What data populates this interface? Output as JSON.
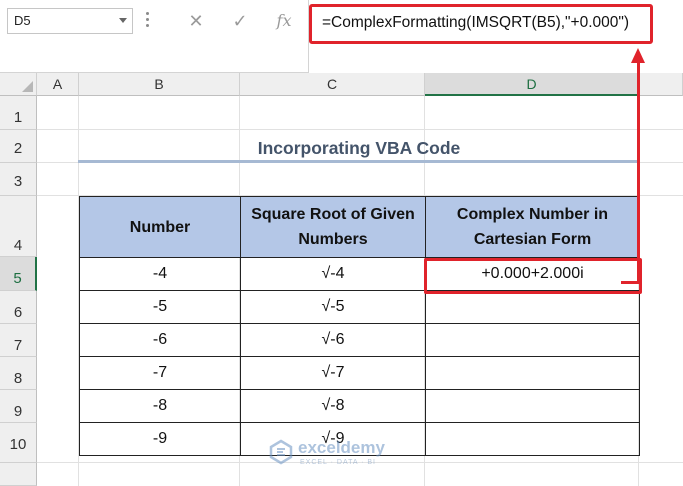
{
  "formula_bar": {
    "name_box": "D5",
    "cancel_icon": "✕",
    "enter_icon": "✓",
    "fx_icon": "fx",
    "formula": "=ComplexFormatting(IMSQRT(B5),\"+0.000\")"
  },
  "columns": [
    "A",
    "B",
    "C",
    "D"
  ],
  "rows": [
    "1",
    "2",
    "3",
    "4",
    "5",
    "6",
    "7",
    "8",
    "9",
    "10"
  ],
  "title": "Incorporating VBA Code",
  "table": {
    "headers": [
      "Number",
      "Square Root of Given Numbers",
      "Complex Number in Cartesian Form"
    ],
    "rows": [
      {
        "number": "-4",
        "root": "√-4",
        "complex": "+0.000+2.000i"
      },
      {
        "number": "-5",
        "root": "√-5",
        "complex": ""
      },
      {
        "number": "-6",
        "root": "√-6",
        "complex": ""
      },
      {
        "number": "-7",
        "root": "√-7",
        "complex": ""
      },
      {
        "number": "-8",
        "root": "√-8",
        "complex": ""
      },
      {
        "number": "-9",
        "root": "√-9",
        "complex": ""
      }
    ]
  },
  "watermark": {
    "name": "exceldemy",
    "tagline": "EXCEL · DATA · BI"
  },
  "colors": {
    "highlight": "#e0232b",
    "header_fill": "#b4c7e7",
    "title": "#44546a"
  }
}
